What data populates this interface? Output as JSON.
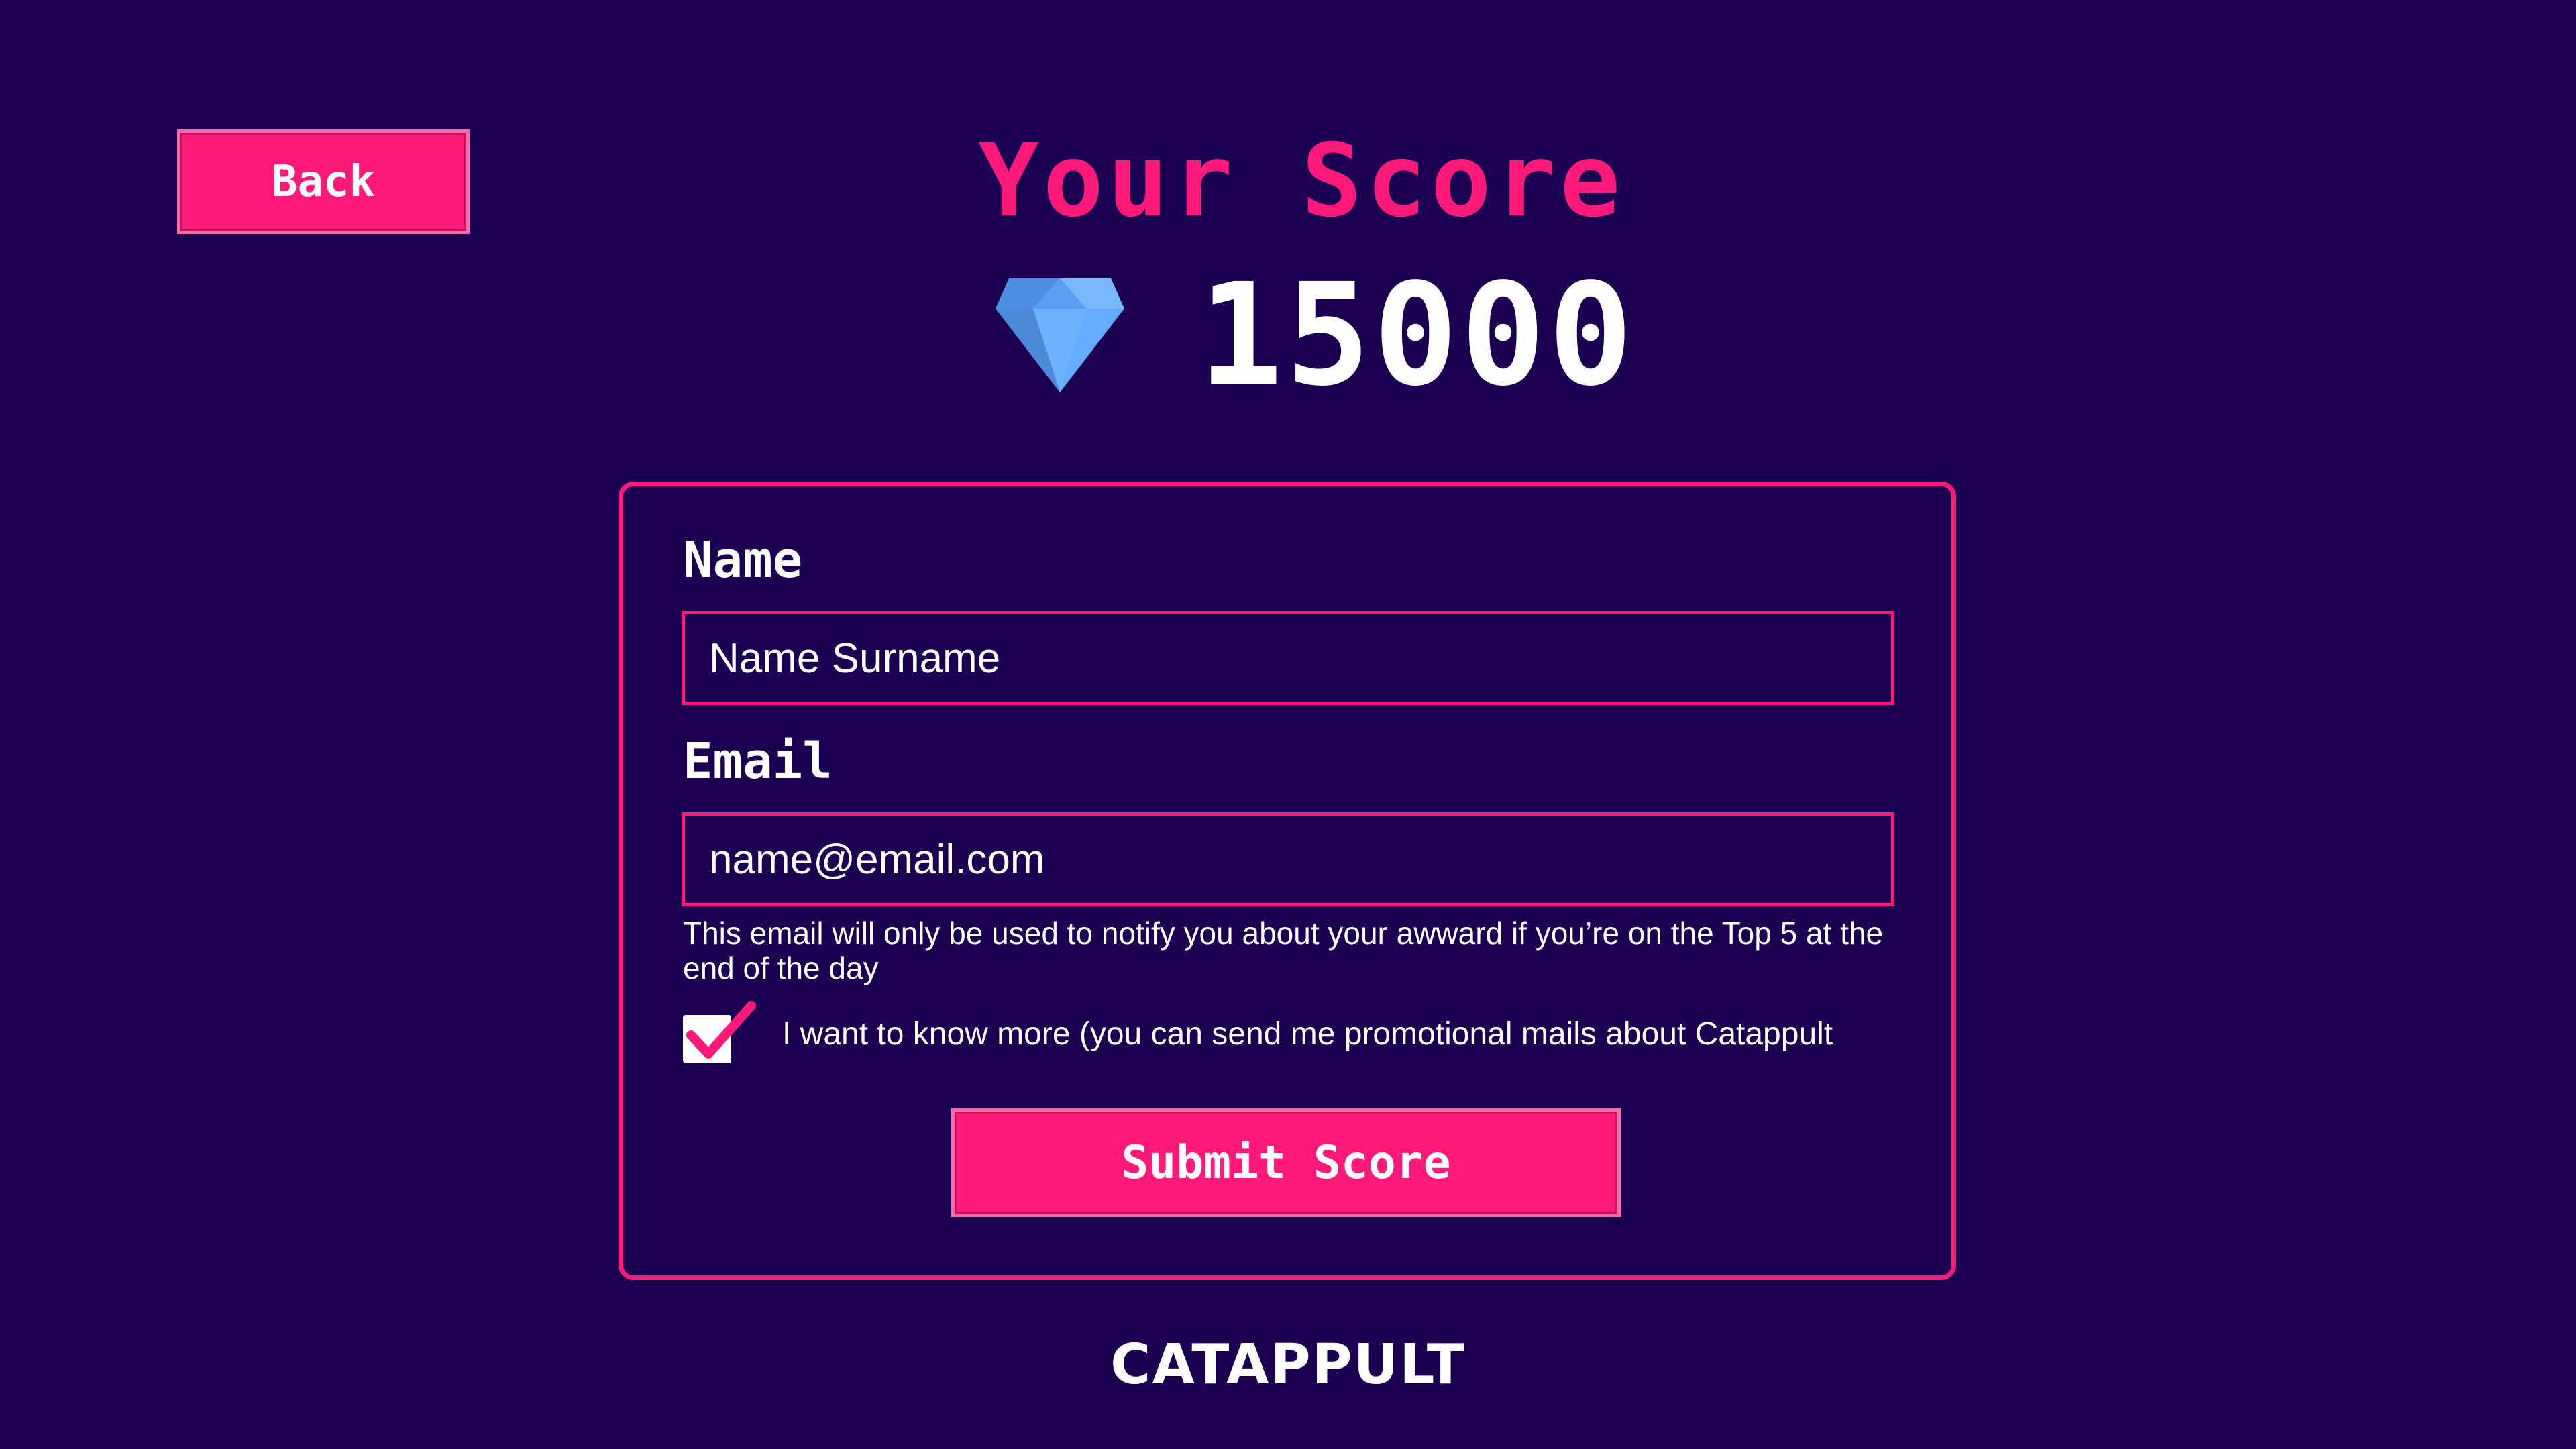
{
  "header": {
    "back_label": "Back",
    "title": "Your Score"
  },
  "score": {
    "icon": "diamond-icon",
    "value": "15000"
  },
  "form": {
    "name": {
      "label": "Name",
      "placeholder": "Name Surname"
    },
    "email": {
      "label": "Email",
      "placeholder": "name@email.com"
    },
    "disclaimer": "This email will only be used to notify you about your awward if you’re on the Top 5 at the end of the day",
    "opt_in": {
      "checked": true,
      "label": "I want to know more (you can send me promotional mails about Catappult"
    },
    "submit_label": "Submit Score"
  },
  "footer": {
    "brand": "CATAPPULT"
  },
  "colors": {
    "background": "#1b0052",
    "accent": "#ff1a7a",
    "text": "#ffffff",
    "gem": "#5aa6ff"
  }
}
